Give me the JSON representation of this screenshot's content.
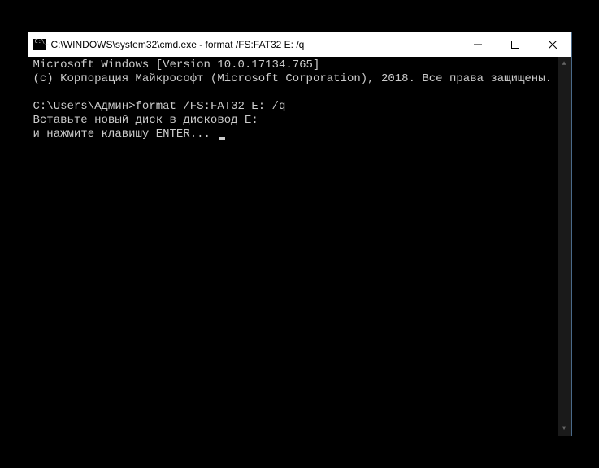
{
  "titlebar": {
    "title": "C:\\WINDOWS\\system32\\cmd.exe - format  /FS:FAT32 E: /q"
  },
  "terminal": {
    "line1": "Microsoft Windows [Version 10.0.17134.765]",
    "line2": "(c) Корпорация Майкрософт (Microsoft Corporation), 2018. Все права защищены.",
    "blank1": "",
    "prompt": "C:\\Users\\Админ>",
    "command": "format /FS:FAT32 E: /q",
    "line3": "Вставьте новый диск в дисковод E:",
    "line4": "и нажмите клавишу ENTER... "
  }
}
